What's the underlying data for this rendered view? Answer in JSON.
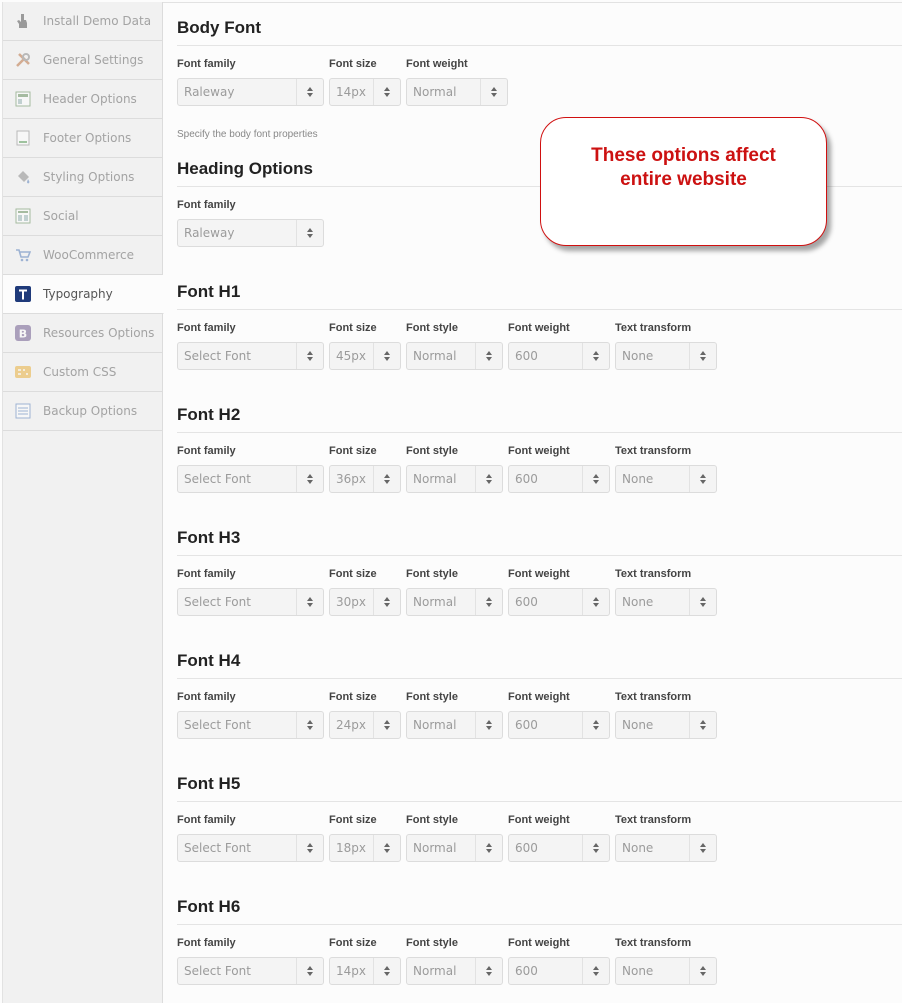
{
  "sidebar": {
    "items": [
      {
        "label": "Install Demo Data",
        "icon": "hand-icon",
        "active": false
      },
      {
        "label": "General Settings",
        "icon": "tools-icon",
        "active": false
      },
      {
        "label": "Header Options",
        "icon": "header-layout-icon",
        "active": false
      },
      {
        "label": "Footer Options",
        "icon": "footer-page-icon",
        "active": false
      },
      {
        "label": "Styling Options",
        "icon": "paint-bucket-icon",
        "active": false
      },
      {
        "label": "Social",
        "icon": "social-grid-icon",
        "active": false
      },
      {
        "label": "WooCommerce",
        "icon": "cart-icon",
        "active": false
      },
      {
        "label": "Typography",
        "icon": "typography-t-icon",
        "active": true
      },
      {
        "label": "Resources Options",
        "icon": "bootstrap-b-icon",
        "active": false
      },
      {
        "label": "Custom CSS",
        "icon": "css-icon",
        "active": false
      },
      {
        "label": "Backup Options",
        "icon": "backup-icon",
        "active": false
      }
    ]
  },
  "body_font": {
    "title": "Body Font",
    "labels": {
      "family": "Font family",
      "size": "Font size",
      "weight": "Font weight"
    },
    "values": {
      "family": "Raleway",
      "size": "14px",
      "weight": "Normal"
    },
    "hint": "Specify the body font properties"
  },
  "heading_options": {
    "title": "Heading Options",
    "labels": {
      "family": "Font family"
    },
    "values": {
      "family": "Raleway"
    }
  },
  "field_labels": {
    "family": "Font family",
    "size": "Font size",
    "style": "Font style",
    "weight": "Font weight",
    "transform": "Text transform"
  },
  "headings": [
    {
      "title": "Font H1",
      "family": "Select Font",
      "size": "45px",
      "style": "Normal",
      "weight": "600",
      "transform": "None"
    },
    {
      "title": "Font H2",
      "family": "Select Font",
      "size": "36px",
      "style": "Normal",
      "weight": "600",
      "transform": "None"
    },
    {
      "title": "Font H3",
      "family": "Select Font",
      "size": "30px",
      "style": "Normal",
      "weight": "600",
      "transform": "None"
    },
    {
      "title": "Font H4",
      "family": "Select Font",
      "size": "24px",
      "style": "Normal",
      "weight": "600",
      "transform": "None"
    },
    {
      "title": "Font H5",
      "family": "Select Font",
      "size": "18px",
      "style": "Normal",
      "weight": "600",
      "transform": "None"
    },
    {
      "title": "Font H6",
      "family": "Select Font",
      "size": "14px",
      "style": "Normal",
      "weight": "600",
      "transform": "None"
    }
  ],
  "callout": {
    "text": "These options affect\nentire website",
    "color": "#cc1111"
  },
  "colors": {
    "sidebar_bg": "#f1f1f1",
    "content_bg": "#fcfcfc",
    "typography_icon": "#1f3a7a"
  }
}
